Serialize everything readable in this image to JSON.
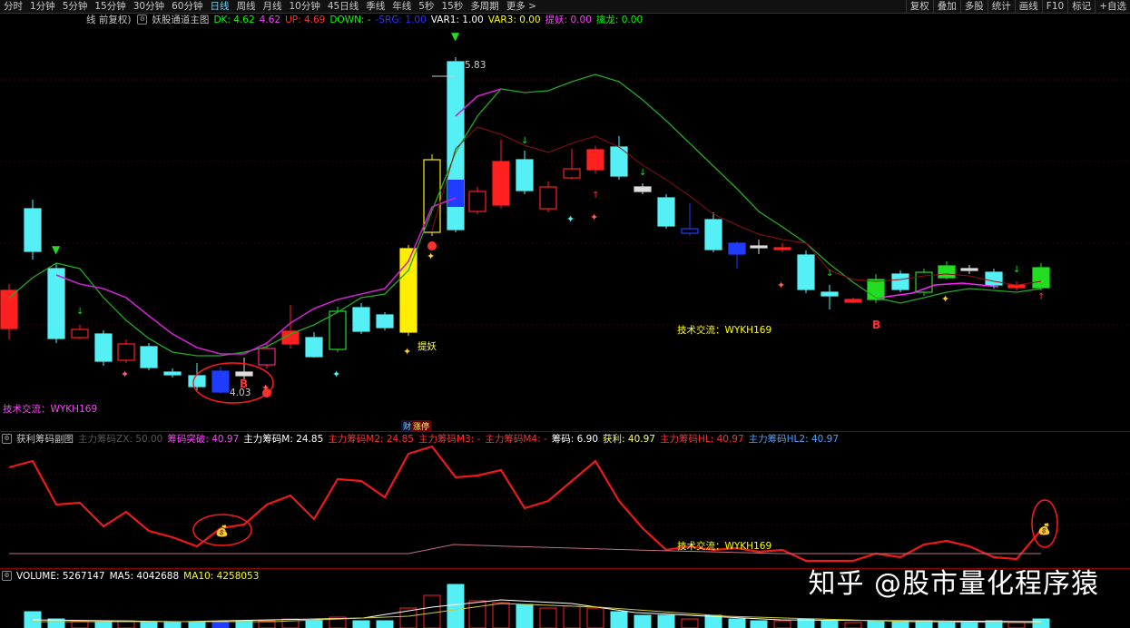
{
  "toolbar": {
    "periods": [
      "分时",
      "1分钟",
      "5分钟",
      "15分钟",
      "30分钟",
      "60分钟",
      "日线",
      "周线",
      "月线",
      "10分钟",
      "45日线",
      "季线",
      "年线",
      "5秒",
      "15秒",
      "多周期",
      "更多 >"
    ],
    "active_index": 6,
    "right": [
      "复权",
      "叠加",
      "多股",
      "统计",
      "画线",
      "F10",
      "标记",
      "+自选"
    ]
  },
  "main": {
    "title_prefix": "线 前复权)",
    "indicator": "妖股通道主图",
    "params": [
      {
        "text": "DK: 4.62",
        "color": "#00ff00"
      },
      {
        "text": "4.62",
        "color": "#ff40ff"
      },
      {
        "text": "UP: 4.69",
        "color": "#ff3030"
      },
      {
        "text": "DOWN: -",
        "color": "#00ff00"
      },
      {
        "text": "-SRG: 1.00",
        "color": "#3030ff"
      },
      {
        "text": "VAR1: 1.00",
        "color": "#ffffff"
      },
      {
        "text": "VAR3: 0.00",
        "color": "#ffff00"
      },
      {
        "text": "提妖: 0.00",
        "color": "#ff40ff"
      },
      {
        "text": "擒龙: 0.00",
        "color": "#00ff00"
      }
    ],
    "high_label": "5.83",
    "low_label": "4.03",
    "b_label": "B",
    "tiyao_label": "提妖",
    "tech_label_1": "技术交流：WYKH169",
    "tech_label_2": "技术交流：WYKH169",
    "cai_label": "财",
    "zhangting_label": "涨停"
  },
  "sub": {
    "indicator": "获利筹码副图",
    "params": [
      {
        "text": "主力筹码ZX: 50.00",
        "color": "#555555"
      },
      {
        "text": "筹码突破: 40.97",
        "color": "#ff40ff"
      },
      {
        "text": "主力筹码M: 24.85",
        "color": "#ffffff"
      },
      {
        "text": "主力筹码M2: 24.85",
        "color": "#ff3030"
      },
      {
        "text": "主力筹码M3: -",
        "color": "#ff3030"
      },
      {
        "text": "主力筹码M4: -",
        "color": "#ff3030"
      },
      {
        "text": "筹码: 6.90",
        "color": "#ffffff"
      },
      {
        "text": "获利: 40.97",
        "color": "#ffff60"
      },
      {
        "text": "主力筹码HL: 40.97",
        "color": "#ff3030"
      },
      {
        "text": "主力筹码HL2: 40.97",
        "color": "#4aa0ff"
      }
    ],
    "tech_label": "技术交流：WYKH169"
  },
  "volume": {
    "params": [
      {
        "text": "VOLUME: 5267147",
        "color": "#ffffff"
      },
      {
        "text": "MA5: 4042688",
        "color": "#ffffff"
      },
      {
        "text": "MA10: 4258053",
        "color": "#ffff00"
      }
    ]
  },
  "watermark": "知乎 @股市量化程序猿"
}
